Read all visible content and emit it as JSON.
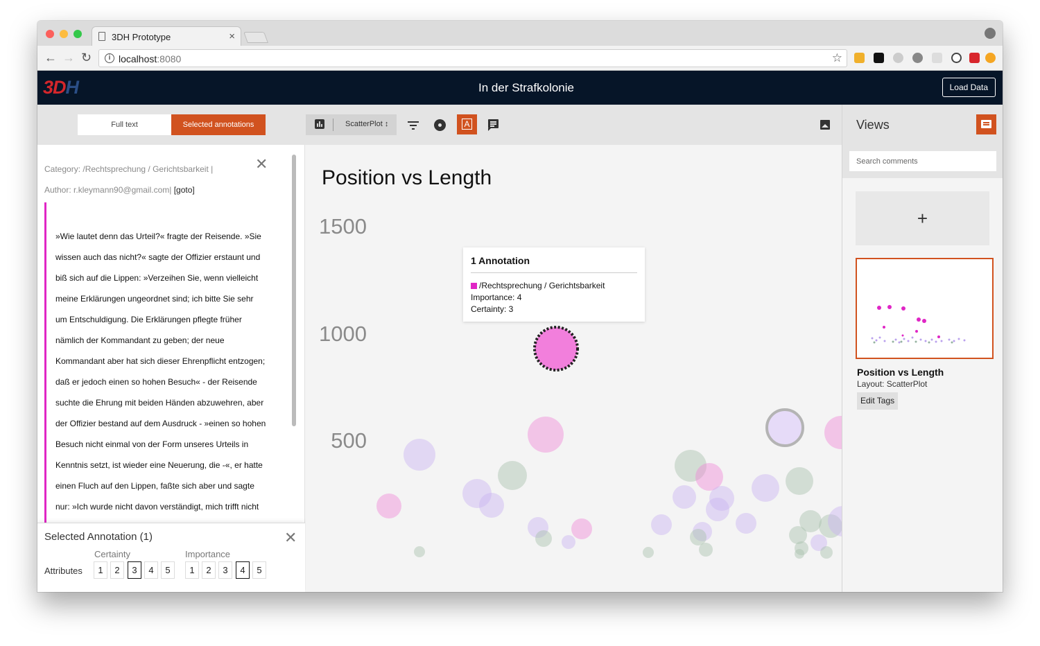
{
  "browser": {
    "tab_title": "3DH Prototype",
    "url_host": "localhost",
    "url_port": ":8080"
  },
  "app": {
    "logo_a": "3D",
    "logo_b": "H",
    "title": "In der Strafkolonie",
    "load_button": "Load Data"
  },
  "toolbar": {
    "full_text": "Full text",
    "selected_annotations": "Selected annotations",
    "layout_select": "ScatterPlot ↕",
    "annotations_button": "A"
  },
  "annotation_detail": {
    "category": "Category: /Rechtsprechung / Gerichtsbarkeit |",
    "author": "Author: r.kleymann90@gmail.com|",
    "goto": "[goto]",
    "lines": [
      "»Wie lautet denn das Urteil?« fragte der Reisende. »Sie",
      "wissen auch das nicht?« sagte der Offizier erstaunt und",
      "biß sich auf die Lippen: »Verzeihen Sie, wenn vielleicht",
      "meine Erklärungen ungeordnet sind; ich bitte Sie sehr",
      "um Entschuldigung. Die Erklärungen pflegte früher",
      "nämlich der Kommandant zu geben; der neue",
      "Kommandant aber hat sich dieser Ehrenpflicht entzogen;",
      "daß er jedoch einen so hohen Besuch« - der Reisende",
      "suchte die Ehrung mit beiden Händen abzuwehren, aber",
      "der Offizier bestand auf dem Ausdruck - »einen so hohen",
      "Besuch nicht einmal von der Form unseres Urteils in",
      "Kenntnis setzt, ist wieder eine Neuerung, die -«, er hatte",
      "einen Fluch auf den Lippen, faßte sich aber und sagte",
      "nur: »Ich wurde nicht davon verständigt, mich trifft nicht"
    ]
  },
  "selected_panel": {
    "title": "Selected Annotation (1)",
    "certainty_label": "Certainty",
    "importance_label": "Importance",
    "attributes_label": "Attributes",
    "options": [
      "1",
      "2",
      "3",
      "4",
      "5"
    ],
    "certainty_value": 3,
    "importance_value": 4
  },
  "chart_data": {
    "type": "scatter",
    "title": "Position vs Length",
    "yticks": [
      "1500",
      "1000",
      "500"
    ],
    "ylim": [
      0,
      1500
    ],
    "highlighted_point": {
      "y": 1000,
      "category": "/Rechtsprechung / Gerichtsbarkeit",
      "importance": 4,
      "certainty": 3
    }
  },
  "tooltip": {
    "title": "1 Annotation",
    "category": "/Rechtsprechung / Gerichtsbarkeit",
    "importance": "Importance: 4",
    "certainty": "Certainty: 3"
  },
  "views": {
    "title": "Views",
    "search_placeholder": "Search comments",
    "add_label": "+",
    "items": [
      {
        "title": "Position vs Length",
        "layout": "Layout: ScatterPlot",
        "edit_tags": "Edit Tags"
      }
    ]
  },
  "colors": {
    "accent": "#d1521f",
    "header": "#061528",
    "pink": "#e026c5",
    "lavender": "#c9b3f2",
    "green": "#a8c0ae"
  }
}
